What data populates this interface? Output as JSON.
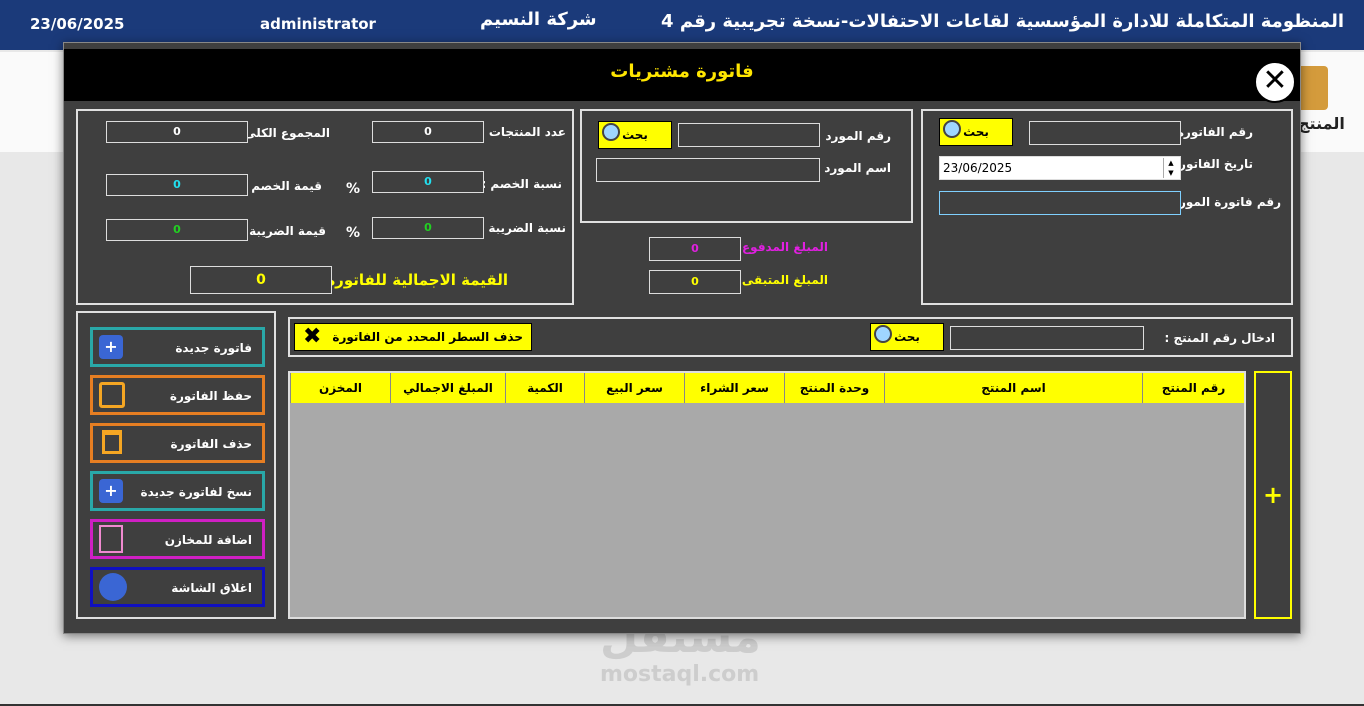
{
  "topbar": {
    "app_title": "المنظومة المتكاملة للادارة المؤسسية لقاعات الاحتفالات-نسخة تجريبية رقم 4",
    "company": "شركة النسيم",
    "user": "administrator",
    "date": "23/06/2025"
  },
  "background": {
    "tile_label": "المنتج",
    "watermark": "مستقل",
    "watermark_url": "mostaql.com"
  },
  "dialog": {
    "title": "فاتورة مشتريات",
    "invoice": {
      "number_label": "رقم الفاتورة :",
      "search_label": "بحث",
      "date_label": "تاريخ الفاتورة :",
      "date_value": "23/06/2025",
      "supplier_invoice_label": "رقم فاتورة المورد :"
    },
    "supplier": {
      "number_label": "رقم المورد :",
      "search_label": "بحث",
      "name_label": "اسم المورد :"
    },
    "payment": {
      "paid_label": "المبلغ المدفوع :",
      "paid_value": "0",
      "remaining_label": "المبلغ المتبقى :",
      "remaining_value": "0"
    },
    "totals": {
      "products_count_label": "عدد المنتجات :",
      "products_count_value": "0",
      "grand_total_label": "المجموع الكلى :",
      "grand_total_value": "0",
      "discount_rate_label": "نسبة الخصم :",
      "discount_rate_value": "0",
      "discount_value_label": "قيمة الخصم :",
      "discount_value": "0",
      "tax_rate_label": "نسبة الضريبة :",
      "tax_rate_value": "0",
      "tax_value_label": "قيمة الضريبة :",
      "tax_value": "0",
      "percent_sign": "%",
      "invoice_total_label": "القيمة الاجمالية للفاتورة :",
      "invoice_total_value": "0"
    },
    "product_entry": {
      "label": "ادخال رقم المنتج :",
      "search_label": "بحث",
      "delete_row_label": "حذف السطر المحدد من الفاتورة"
    },
    "table": {
      "columns": [
        "رقم المنتج",
        "اسم المنتج",
        "وحدة المنتج",
        "سعر الشراء",
        "سعر البيع",
        "الكمية",
        "المبلغ الاجمالي",
        "المخزن"
      ],
      "add_label": "+"
    },
    "actions": [
      {
        "label": "فاتورة جديدة",
        "icon": "plus-icon",
        "color": "#29a8a8"
      },
      {
        "label": "حفظ الفاتورة",
        "icon": "save-icon",
        "color": "#e67e22"
      },
      {
        "label": "حذف الفاتورة",
        "icon": "trash-icon",
        "color": "#e67e22"
      },
      {
        "label": "نسخ لفاتورة جديدة",
        "icon": "plus-icon",
        "color": "#29a8a8"
      },
      {
        "label": "اضافة للمخازن",
        "icon": "edit-icon",
        "color": "#d01fc4"
      },
      {
        "label": "اغلاق الشاشة",
        "icon": "power-icon",
        "color": "#1010c0"
      }
    ]
  }
}
